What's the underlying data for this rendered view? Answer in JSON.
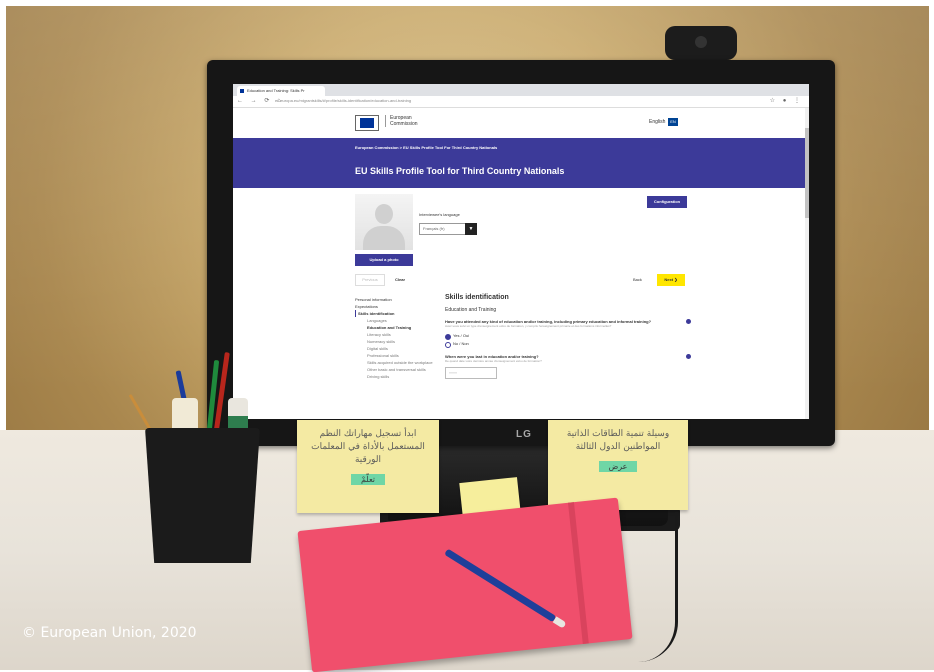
{
  "browser": {
    "tab_title": "Education and Training: Skills Pr",
    "url": "ec.europa.eu/migrantskills/#/profile/skills-identification/education-and-training"
  },
  "site_header": {
    "org_name": "European Commission",
    "language": "English",
    "language_code": "EN"
  },
  "banner": {
    "breadcrumb": "European Commission  >  EU Skills Profile Tool For Third Country Nationals",
    "title": "EU Skills Profile Tool for Third Country Nationals"
  },
  "profile": {
    "upload_label": "Upload a photo",
    "configuration_label": "Configuration",
    "interviewee_language_label": "Interviewee's language",
    "interviewee_language_value": "Français (fr)"
  },
  "actions": {
    "previous": "Previous",
    "clear": "Clear",
    "back": "Back",
    "next": "Next  ❯"
  },
  "sidenav": {
    "items": [
      {
        "label": "Personal information"
      },
      {
        "label": "Expectations"
      },
      {
        "label": "Skills identification"
      }
    ],
    "sub_items": [
      {
        "label": "Languages"
      },
      {
        "label": "Education and Training"
      },
      {
        "label": "Literacy skills"
      },
      {
        "label": "Numeracy skills"
      },
      {
        "label": "Digital skills"
      },
      {
        "label": "Professional skills"
      },
      {
        "label": "Skills acquired outside the workplace"
      },
      {
        "label": "Other basic and transversal skills"
      },
      {
        "label": "Driving skills"
      }
    ]
  },
  "main": {
    "heading": "Skills identification",
    "section": "Education and Training",
    "q1": "Have you attended any kind of education and/or training, including primary education and informal training?",
    "q1_hint": "Avez-vous suivi un type d'enseignement et/ou de formation, y compris l'enseignement primaire et des formations informelles?",
    "q1_options": [
      "Yes / Oui",
      "No / Non"
    ],
    "q2": "When were you last in education and/or training?",
    "q2_hint": "De quand date votre dernière année d'enseignement et/ou de formation?",
    "q2_placeholder": "YYYY"
  },
  "notes": {
    "left_text": "ابدأ تسجيل مهاراتك النظم المستعمل بالأداة في المعلمات الورقية",
    "left_tag": "تعلّمْ",
    "right_text": "وسيلة تنمية الطاقات الذاتية المواطنين الدول الثالثة",
    "right_tag": "عرض"
  },
  "monitor_brand": "LG",
  "copyright": "© European Union, 2020"
}
